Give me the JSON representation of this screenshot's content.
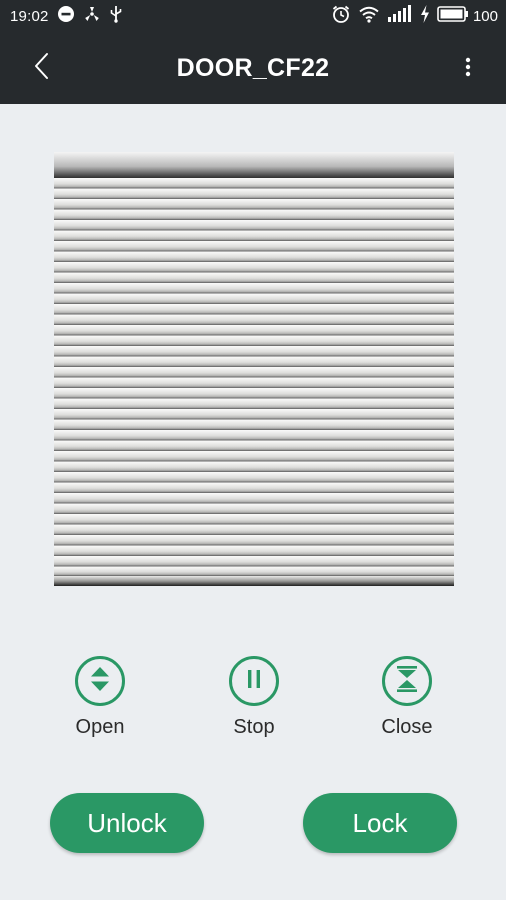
{
  "status_bar": {
    "time": "19:02",
    "battery_level": "100",
    "left_icons": [
      "minus-circle-icon",
      "fan-icon",
      "usb-icon"
    ],
    "right_icons": [
      "alarm-icon",
      "wifi-icon",
      "signal-icon",
      "charging-bolt-icon",
      "battery-icon"
    ]
  },
  "app_bar": {
    "title": "DOOR_CF22",
    "back_icon": "chevron-left-icon",
    "menu_icon": "more-vertical-icon"
  },
  "controls": {
    "open_label": "Open",
    "stop_label": "Stop",
    "close_label": "Close"
  },
  "actions": {
    "unlock_label": "Unlock",
    "lock_label": "Lock"
  },
  "colors": {
    "accent": "#2a9865",
    "bar_background": "#262a2d",
    "page_background": "#ebeef1"
  }
}
